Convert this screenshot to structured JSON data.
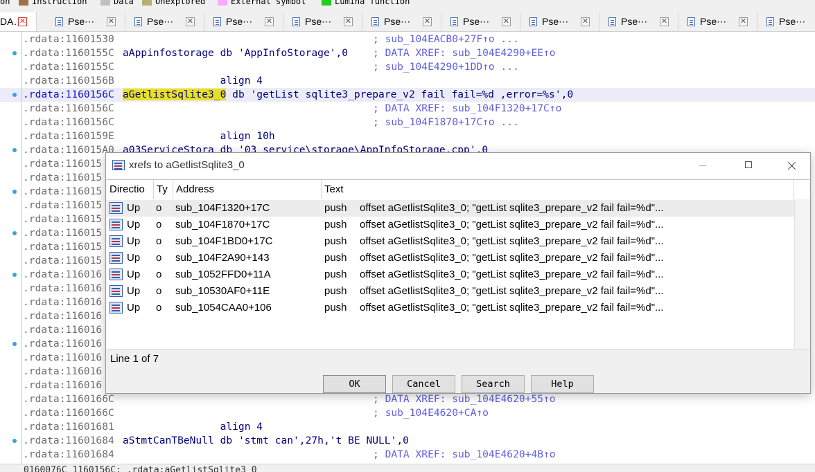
{
  "legend": [
    {
      "label": "on",
      "color": ""
    },
    {
      "label": "Instruction",
      "color": "#a0724a"
    },
    {
      "label": "Data",
      "color": "#c0c0c0"
    },
    {
      "label": "Unexplored",
      "color": "#b8b070"
    },
    {
      "label": "External symbol",
      "color": "#ffa8ff"
    },
    {
      "label": "Lumina function",
      "color": "#22cc22"
    }
  ],
  "tabs": [
    {
      "label": "DA…",
      "icon": "close-icon-red"
    },
    {
      "label": "Pse⋯"
    },
    {
      "label": "Pse⋯"
    },
    {
      "label": "Pse⋯"
    },
    {
      "label": "Pse⋯"
    },
    {
      "label": "Pse⋯"
    },
    {
      "label": "Pse⋯"
    },
    {
      "label": "Pse⋯"
    },
    {
      "label": "Pse⋯"
    },
    {
      "label": "Pse⋯"
    },
    {
      "label": "Pse⋯"
    }
  ],
  "listing": [
    {
      "addr": ".rdata:11601530",
      "name": "",
      "body": "",
      "cmt": "; sub_104EACB0+27F↑o ...",
      "dot": false
    },
    {
      "addr": ".rdata:1160155C",
      "name": "aAppinfostorage",
      "body": " db 'AppInfoStorage',0",
      "cmt": "; DATA XREF: sub_104E4290+EE↑o",
      "dot": true
    },
    {
      "addr": ".rdata:1160155C",
      "name": "",
      "body": "",
      "cmt": "; sub_104E4290+1DD↑o ...",
      "dot": false
    },
    {
      "addr": ".rdata:1160156B",
      "name": "",
      "body": "                align 4",
      "cmt": "",
      "dot": false
    },
    {
      "addr": ".rdata:1160156C",
      "name": "aGetlistSqlite3_0",
      "body": " db 'getList sqlite3_prepare_v2 fail fail=%d ,error=%s',0",
      "cmt": "",
      "dot": true,
      "current": true
    },
    {
      "addr": ".rdata:1160156C",
      "name": "",
      "body": "",
      "cmt": "; DATA XREF: sub_104F1320+17C↑o",
      "dot": false
    },
    {
      "addr": ".rdata:1160156C",
      "name": "",
      "body": "",
      "cmt": "; sub_104F1870+17C↑o ...",
      "dot": false
    },
    {
      "addr": ".rdata:1160159E",
      "name": "",
      "body": "                align 10h",
      "cmt": "",
      "dot": false
    },
    {
      "addr": ".rdata:116015A0",
      "name": "a03ServiceStora",
      "body": " db '03 service\\storage\\AppInfoStorage.cpp',0",
      "cmt": "",
      "dot": true
    },
    {
      "addr": ".rdata:116015",
      "name": "",
      "body": "",
      "cmt": "",
      "dot": false
    },
    {
      "addr": ".rdata:116015",
      "name": "",
      "body": "",
      "cmt": "",
      "dot": false
    },
    {
      "addr": ".rdata:116015",
      "name": "",
      "body": "",
      "cmt": "",
      "dot": true
    },
    {
      "addr": ".rdata:116015",
      "name": "",
      "body": "",
      "cmt": "",
      "dot": false
    },
    {
      "addr": ".rdata:116015",
      "name": "",
      "body": "",
      "cmt": "",
      "dot": false
    },
    {
      "addr": ".rdata:116015",
      "name": "",
      "body": "",
      "cmt": "",
      "dot": true
    },
    {
      "addr": ".rdata:116015",
      "name": "",
      "body": "",
      "cmt": "",
      "dot": false
    },
    {
      "addr": ".rdata:116015",
      "name": "",
      "body": "",
      "cmt": "",
      "dot": false
    },
    {
      "addr": ".rdata:116016",
      "name": "",
      "body": "",
      "cmt": "",
      "dot": true
    },
    {
      "addr": ".rdata:116016",
      "name": "",
      "body": "",
      "cmt": "",
      "dot": false
    },
    {
      "addr": ".rdata:116016",
      "name": "",
      "body": "",
      "cmt": "",
      "dot": false
    },
    {
      "addr": ".rdata:116016",
      "name": "",
      "body": "",
      "cmt": "",
      "dot": false
    },
    {
      "addr": ".rdata:116016",
      "name": "",
      "body": "",
      "cmt": "",
      "dot": false
    },
    {
      "addr": ".rdata:116016",
      "name": "",
      "body": "",
      "cmt": "",
      "dot": true
    },
    {
      "addr": ".rdata:116016",
      "name": "",
      "body": "",
      "cmt": "",
      "dot": false
    },
    {
      "addr": ".rdata:116016",
      "name": "",
      "body": "",
      "cmt": "",
      "dot": false
    },
    {
      "addr": ".rdata:116016",
      "name": "",
      "body": "",
      "cmt": "",
      "dot": false
    },
    {
      "addr": ".rdata:1160166C",
      "name": "",
      "body": "",
      "cmt": "; DATA XREF: sub_104E4620+55↑o",
      "dot": false
    },
    {
      "addr": ".rdata:1160166C",
      "name": "",
      "body": "",
      "cmt": "; sub_104E4620+CA↑o",
      "dot": false
    },
    {
      "addr": ".rdata:11601681",
      "name": "",
      "body": "                align 4",
      "cmt": "",
      "dot": false
    },
    {
      "addr": ".rdata:11601684",
      "name": "aStmtCanTBeNull",
      "body": " db 'stmt can',27h,'t BE NULL',0",
      "cmt": "",
      "dot": true
    },
    {
      "addr": ".rdata:11601684",
      "name": "",
      "body": "",
      "cmt": "; DATA XREF: sub_104E4620+4B↑o",
      "dot": false
    }
  ],
  "status_text": "0160076C 1160156C: .rdata:aGetlistSqlite3_0",
  "dialog": {
    "title": "xrefs to aGetlistSqlite3_0",
    "columns": [
      "Directio",
      "Ty",
      "Address",
      "Text"
    ],
    "rows": [
      {
        "dir": "Up",
        "type": "o",
        "address": "sub_104F1320+17C",
        "mnem": "push",
        "text": "offset aGetlistSqlite3_0; \"getList sqlite3_prepare_v2 fail fail=%d\"..."
      },
      {
        "dir": "Up",
        "type": "o",
        "address": "sub_104F1870+17C",
        "mnem": "push",
        "text": "offset aGetlistSqlite3_0; \"getList sqlite3_prepare_v2 fail fail=%d\"..."
      },
      {
        "dir": "Up",
        "type": "o",
        "address": "sub_104F1BD0+17C",
        "mnem": "push",
        "text": "offset aGetlistSqlite3_0; \"getList sqlite3_prepare_v2 fail fail=%d\"..."
      },
      {
        "dir": "Up",
        "type": "o",
        "address": "sub_104F2A90+143",
        "mnem": "push",
        "text": "offset aGetlistSqlite3_0; \"getList sqlite3_prepare_v2 fail fail=%d\"..."
      },
      {
        "dir": "Up",
        "type": "o",
        "address": "sub_1052FFD0+11A",
        "mnem": "push",
        "text": "offset aGetlistSqlite3_0; \"getList sqlite3_prepare_v2 fail fail=%d\"..."
      },
      {
        "dir": "Up",
        "type": "o",
        "address": "sub_10530AF0+11E",
        "mnem": "push",
        "text": "offset aGetlistSqlite3_0; \"getList sqlite3_prepare_v2 fail fail=%d\"..."
      },
      {
        "dir": "Up",
        "type": "o",
        "address": "sub_1054CAA0+106",
        "mnem": "push",
        "text": "offset aGetlistSqlite3_0; \"getList sqlite3_prepare_v2 fail fail=%d\"..."
      }
    ],
    "line_count": "Line 1 of 7",
    "buttons": {
      "ok": "OK",
      "cancel": "Cancel",
      "search": "Search",
      "help": "Help"
    }
  }
}
